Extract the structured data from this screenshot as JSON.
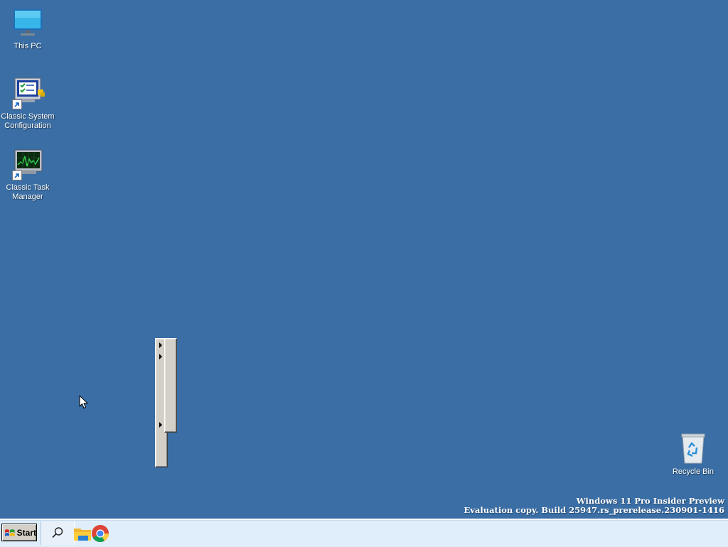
{
  "desktop": {
    "icons": [
      {
        "label": "This PC"
      },
      {
        "label": "Classic System Configuration"
      },
      {
        "label": "Classic Task Manager"
      },
      {
        "label": "Recycle Bin"
      }
    ],
    "watermark": {
      "line1": "Windows 11 Pro Insider Preview",
      "line2": "Evaluation copy. Build 25947.rs_prerelease.230901-1416"
    }
  },
  "taskbar": {
    "start_label": "Start",
    "pinned": [
      {
        "icon": "search-icon"
      },
      {
        "icon": "file-explorer-icon"
      },
      {
        "icon": "chrome-icon"
      }
    ]
  },
  "colors": {
    "desktop": "#3a6ea5",
    "taskbar": "#dfeefa",
    "menu_face": "#d4d0c8"
  }
}
